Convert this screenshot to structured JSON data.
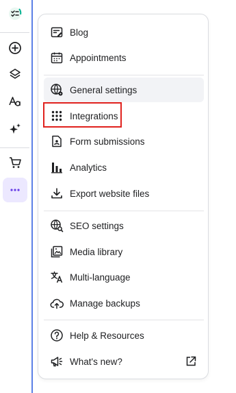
{
  "colors": {
    "accent_purple": "#673de6",
    "active_bg": "#ece8ff",
    "highlight_red": "#e0211d"
  },
  "rail": {
    "items": [
      {
        "icon": "checklist-icon"
      },
      {
        "icon": "add-circle-icon"
      },
      {
        "icon": "layers-icon"
      },
      {
        "icon": "text-style-icon"
      },
      {
        "icon": "sparkles-icon"
      },
      {
        "icon": "cart-icon"
      },
      {
        "icon": "more-horizontal-icon"
      }
    ]
  },
  "menu": {
    "blog": "Blog",
    "appointments": "Appointments",
    "general_settings": "General settings",
    "integrations": "Integrations",
    "form_submissions": "Form submissions",
    "analytics": "Analytics",
    "export_files": "Export website files",
    "seo_settings": "SEO settings",
    "media_library": "Media library",
    "multi_language": "Multi-language",
    "manage_backups": "Manage backups",
    "help_resources": "Help & Resources",
    "whats_new": "What's new?"
  }
}
